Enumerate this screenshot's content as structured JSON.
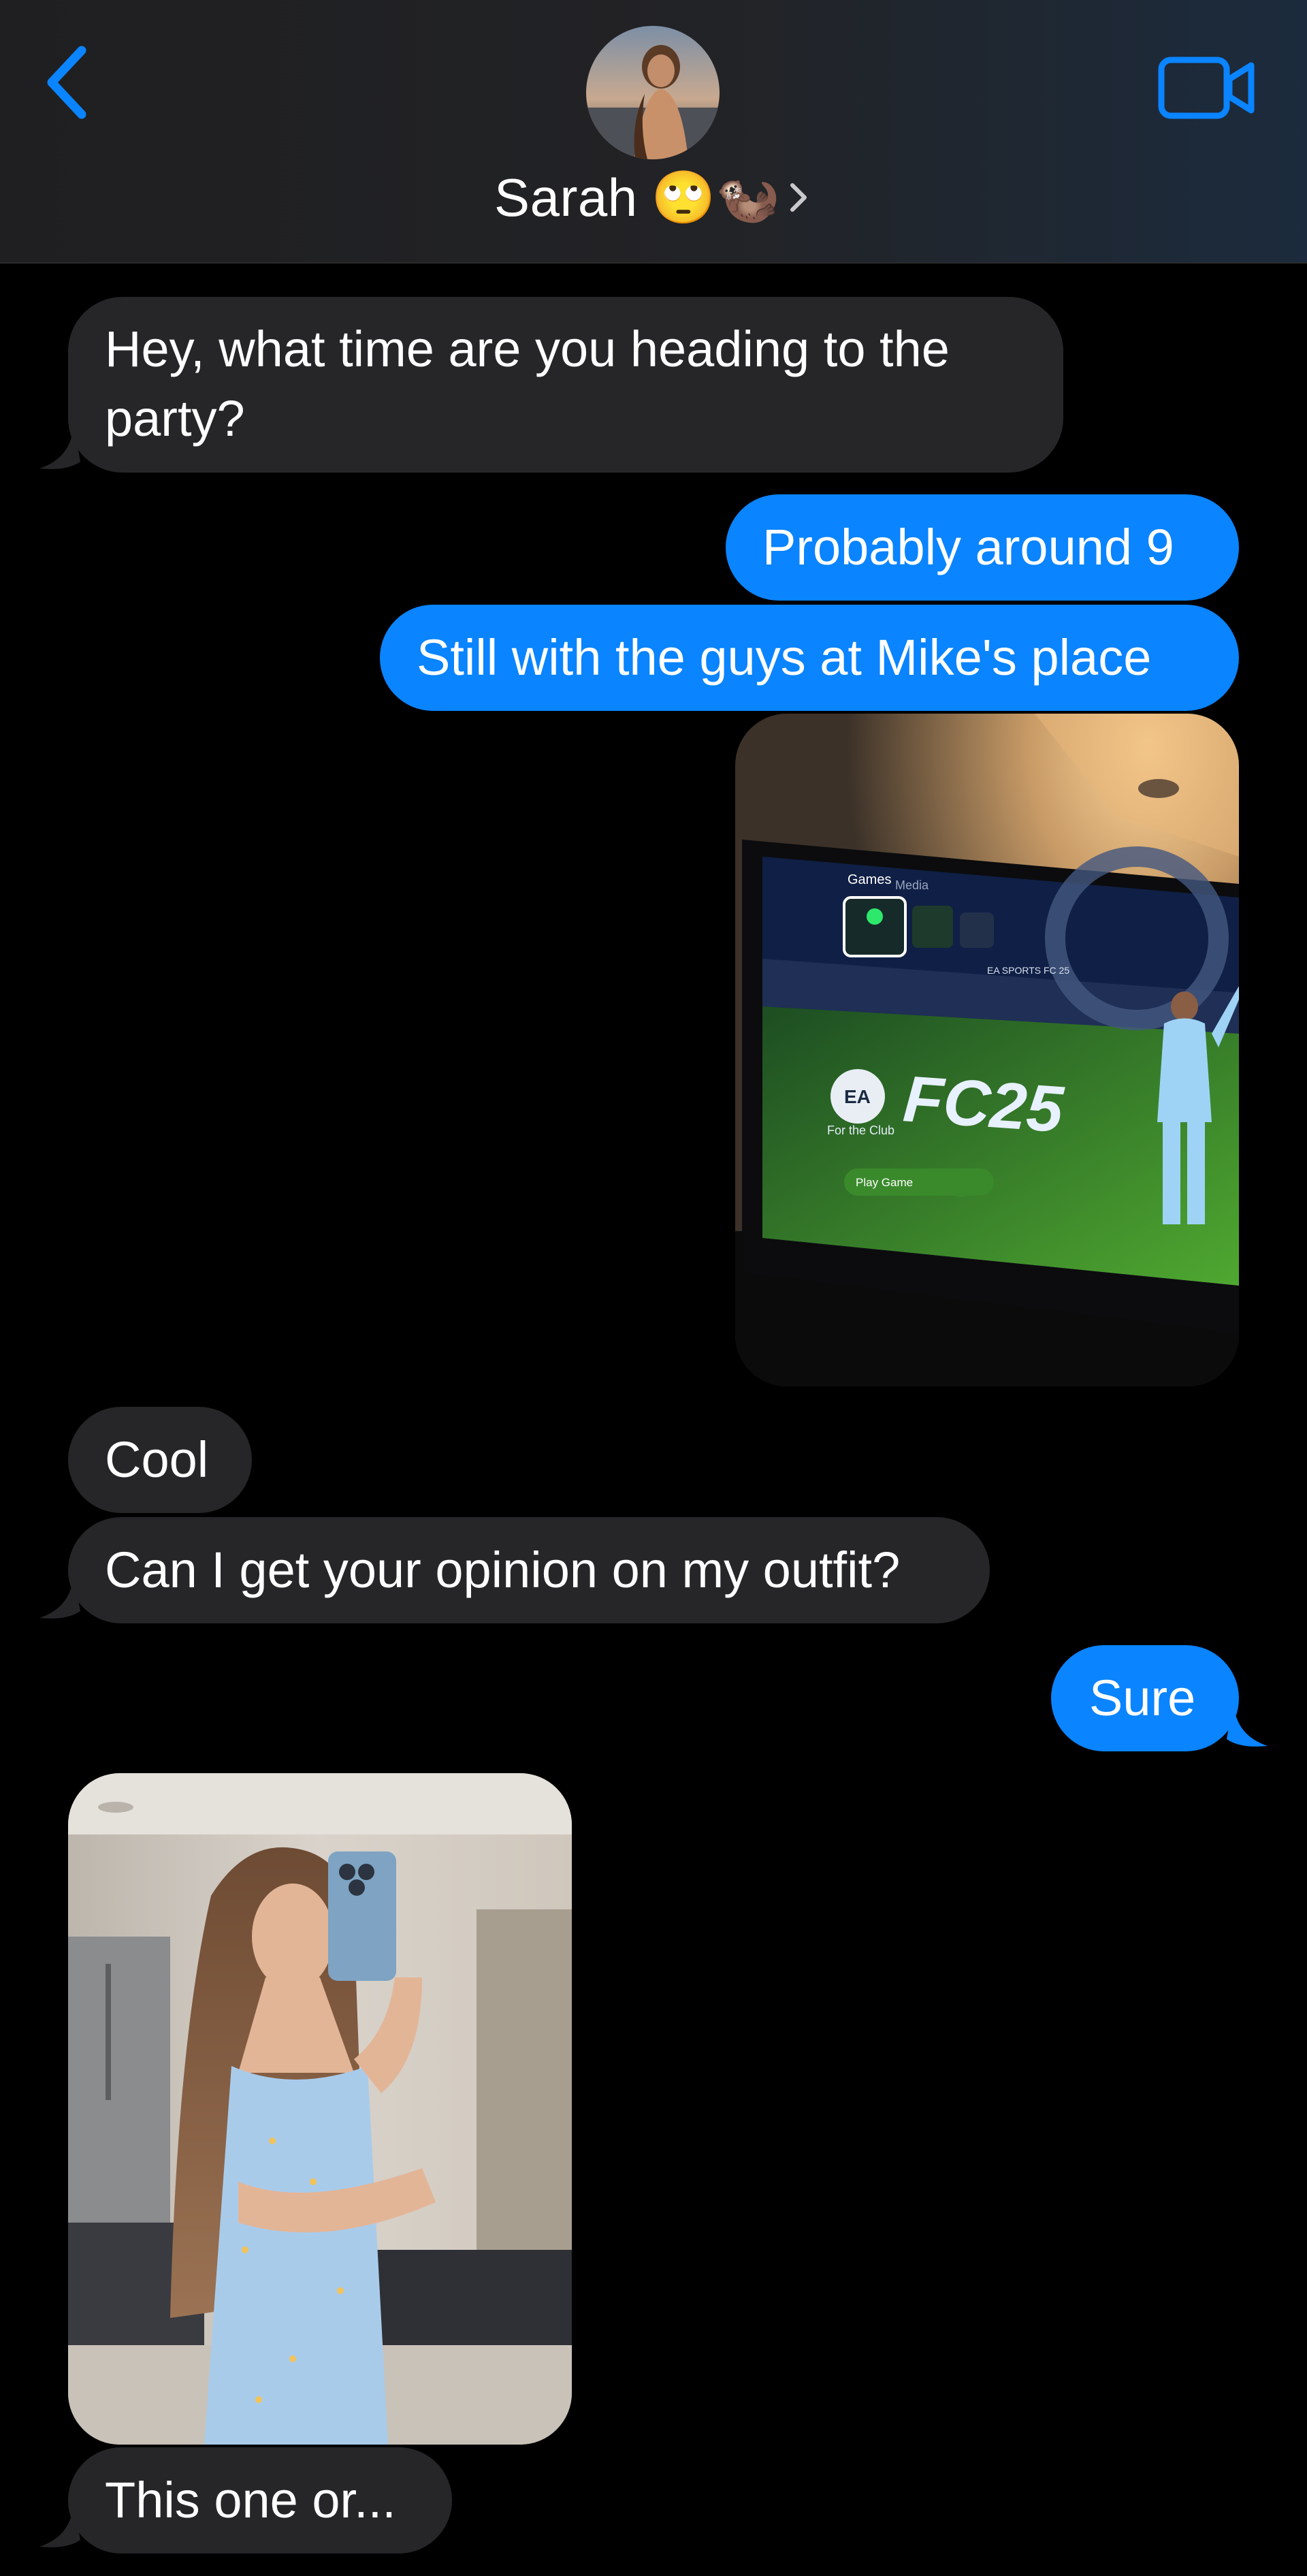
{
  "header": {
    "contact_name": "Sarah",
    "contact_emoji": "🙄🦦"
  },
  "messages": [
    {
      "from": "them",
      "text": "Hey, what time are you heading to the party?"
    },
    {
      "from": "me",
      "text": "Probably around 9"
    },
    {
      "from": "me",
      "text": "Still with the guys at Mike's place"
    },
    {
      "from": "me",
      "type": "image",
      "screen_text": {
        "tab_games": "Games",
        "tab_media": "Media",
        "game_title": "FC25",
        "subtitle": "For the Club",
        "play": "Play Game",
        "label": "EA SPORTS FC 25",
        "brand": "EA"
      }
    },
    {
      "from": "them",
      "text": "Cool"
    },
    {
      "from": "them",
      "text": "Can I get your opinion on my outfit?"
    },
    {
      "from": "me",
      "text": "Sure"
    },
    {
      "from": "them",
      "type": "image"
    },
    {
      "from": "them",
      "text": "This one or..."
    }
  ],
  "colors": {
    "incoming": "#262629",
    "outgoing": "#0a84ff",
    "accent": "#0a84ff"
  },
  "icons": {
    "back": "chevron-left-icon",
    "video": "video-camera-icon",
    "disclosure": "chevron-right-icon"
  }
}
